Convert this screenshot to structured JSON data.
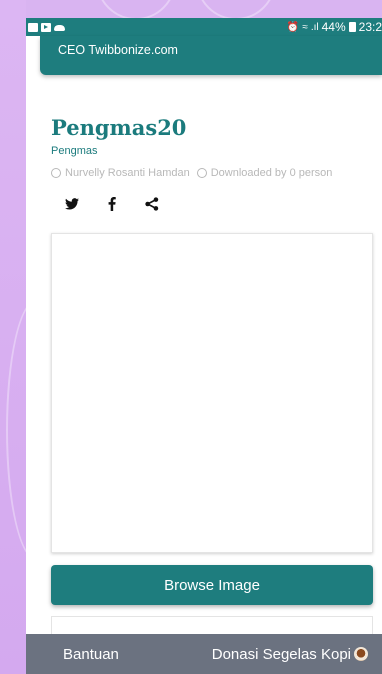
{
  "status_bar": {
    "battery": "44%",
    "time": "23:2",
    "icons": [
      "sim-icon",
      "youtube-icon",
      "cloud-icon",
      "alarm-icon",
      "wifi-icon",
      "signal-icon",
      "battery-icon"
    ]
  },
  "header": {
    "ceo_text": "CEO Twibbonize.com"
  },
  "campaign": {
    "title": "Pengmas20",
    "category": "Pengmas",
    "author": "Nurvelly Rosanti Hamdan",
    "downloads": "Downloaded by 0 person"
  },
  "share": {
    "icons": [
      "twitter-icon",
      "facebook-icon",
      "share-icon"
    ]
  },
  "actions": {
    "browse_label": "Browse Image"
  },
  "bottom_nav": {
    "help_label": "Bantuan",
    "donate_label": "Donasi Segelas Kopi"
  },
  "colors": {
    "accent": "#1e7d7e",
    "background": "#d9b3f2",
    "bottom_nav": "#6b7280",
    "meta_text": "#b8b8b8"
  }
}
